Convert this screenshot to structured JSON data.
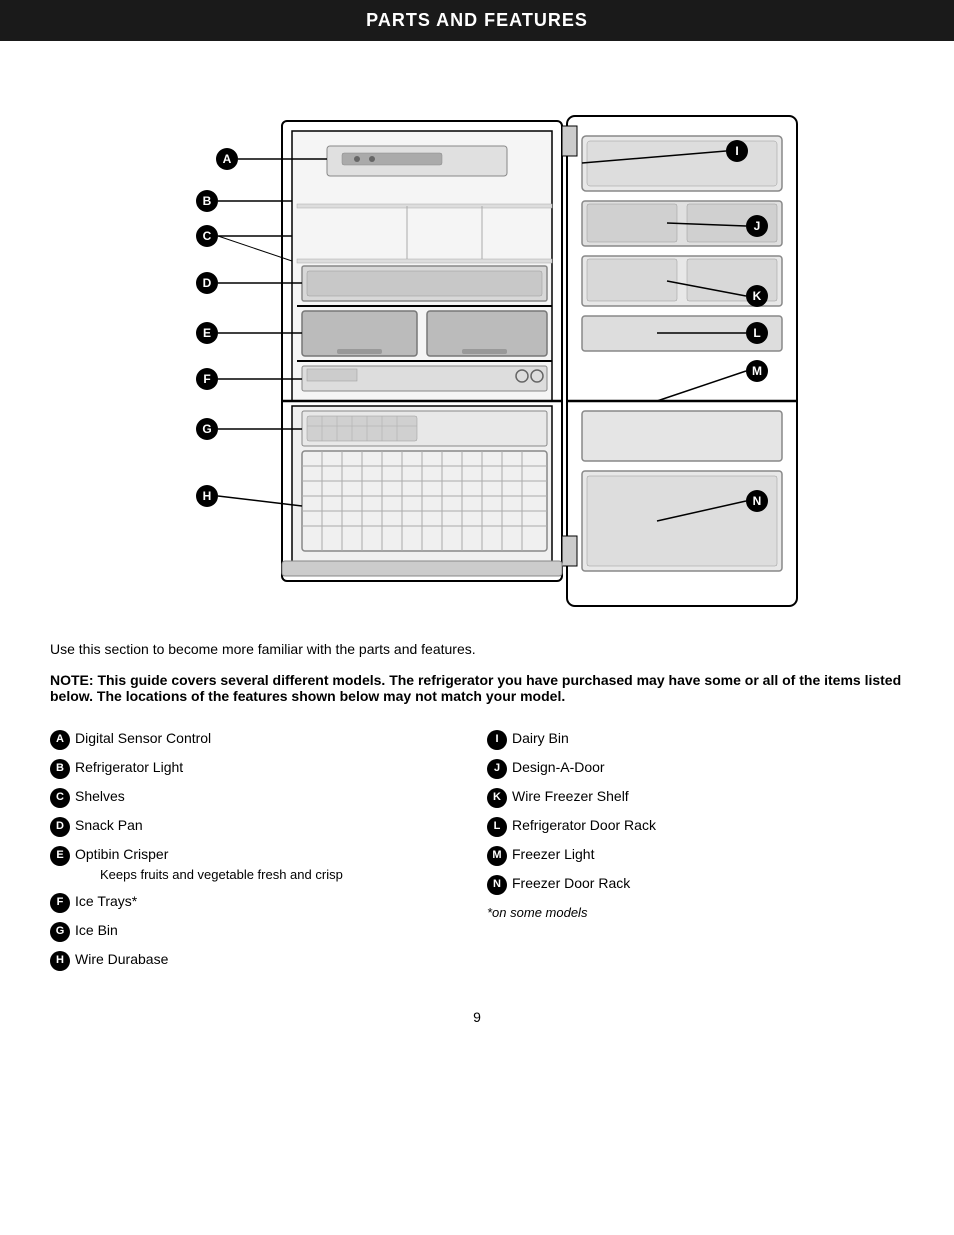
{
  "header": {
    "title": "PARTS AND FEATURES"
  },
  "intro": {
    "text": "Use this section to become more familiar with the parts and features."
  },
  "note": {
    "text": "NOTE: This guide covers several different models. The refrigerator you have purchased may have some or all of the items listed below. The locations of the features shown below may not match your model."
  },
  "parts_left": [
    {
      "id": "A",
      "label": "Digital Sensor Control",
      "sub": ""
    },
    {
      "id": "B",
      "label": "Refrigerator Light",
      "sub": ""
    },
    {
      "id": "C",
      "label": "Shelves",
      "sub": ""
    },
    {
      "id": "D",
      "label": "Snack Pan",
      "sub": ""
    },
    {
      "id": "E",
      "label": "Optibin Crisper",
      "sub": "Keeps fruits and vegetable fresh and crisp"
    },
    {
      "id": "F",
      "label": "Ice Trays*",
      "sub": ""
    },
    {
      "id": "G",
      "label": "Ice Bin",
      "sub": ""
    },
    {
      "id": "H",
      "label": "Wire Durabase",
      "sub": ""
    }
  ],
  "parts_right": [
    {
      "id": "I",
      "label": "Dairy Bin",
      "sub": ""
    },
    {
      "id": "J",
      "label": "Design-A-Door",
      "sub": ""
    },
    {
      "id": "K",
      "label": "Wire Freezer Shelf",
      "sub": ""
    },
    {
      "id": "L",
      "label": "Refrigerator Door Rack",
      "sub": ""
    },
    {
      "id": "M",
      "label": "Freezer Light",
      "sub": ""
    },
    {
      "id": "N",
      "label": "Freezer Door Rack",
      "sub": ""
    }
  ],
  "asterisk_note": "*on some models",
  "page_number": "9"
}
